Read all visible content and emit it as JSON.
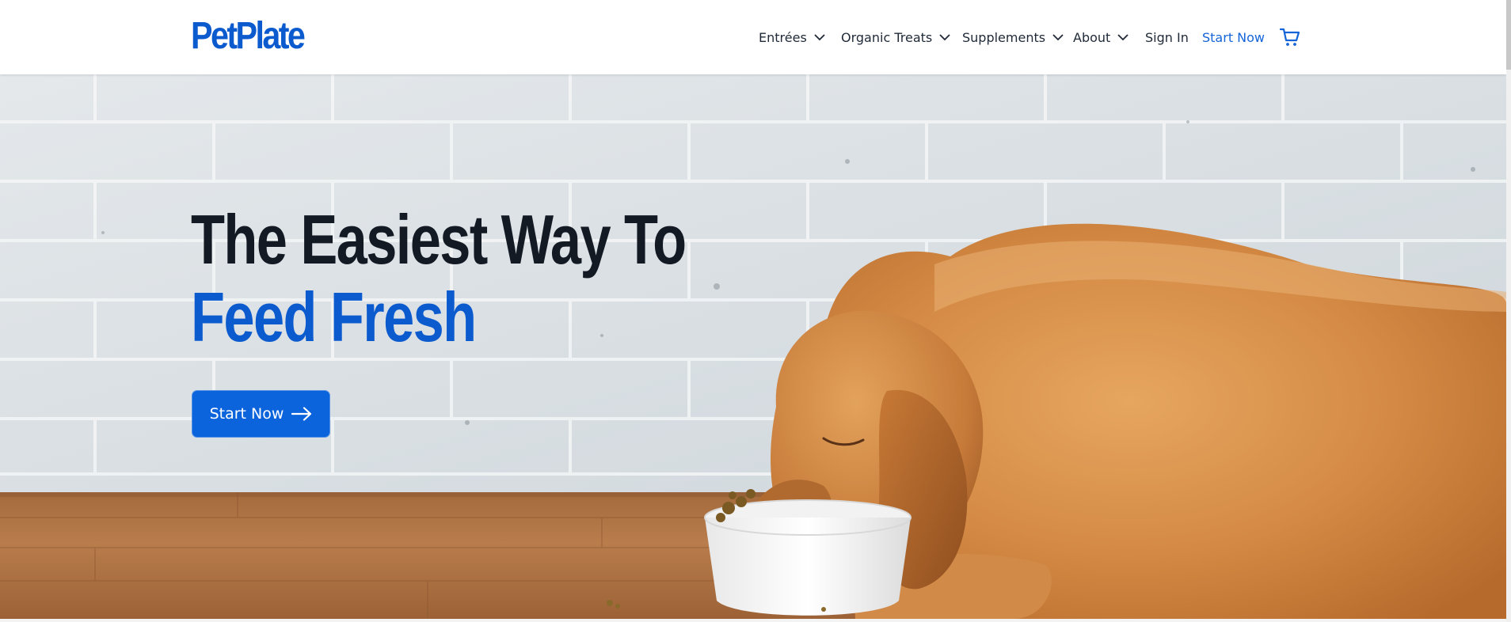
{
  "brand": {
    "logo_text": "PetPlate",
    "color": "#0b5bcf"
  },
  "nav": {
    "items": [
      {
        "label": "Entrées",
        "has_dropdown": true
      },
      {
        "label": "Organic Treats",
        "has_dropdown": true
      },
      {
        "label": "Supplements",
        "has_dropdown": true
      },
      {
        "label": "About",
        "has_dropdown": true
      },
      {
        "label": "Sign In",
        "has_dropdown": false
      }
    ],
    "cta_label": "Start Now",
    "cart_icon": "cart-icon"
  },
  "hero": {
    "headline_line1": "The Easiest Way To",
    "headline_line2": "Feed Fresh",
    "cta_label": "Start Now",
    "cta_icon": "arrow-right-icon",
    "image_subject": "golden retriever puppy eating from white bowl"
  },
  "colors": {
    "accent": "#0c64dc",
    "headline_dark": "#141a24",
    "nav_text": "#1f2937"
  }
}
